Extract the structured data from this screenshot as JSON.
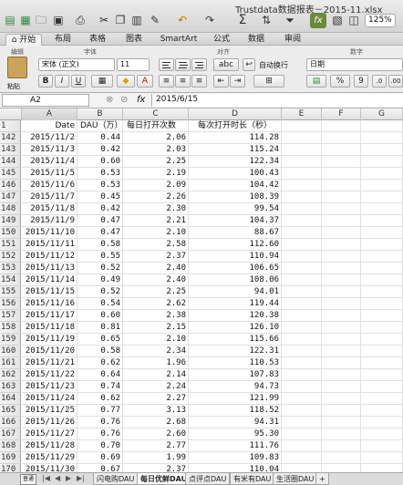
{
  "window": {
    "title": "Trustdata数据报表－2015-11.xlsx",
    "zoom": "125%"
  },
  "toolbar_icons": [
    "new-icon",
    "open-icon",
    "save-icon",
    "print-icon",
    "cut-icon",
    "copy-icon",
    "paste-icon",
    "format-painter-icon",
    "undo-icon",
    "redo-icon",
    "sum-icon",
    "sort-icon",
    "filter-icon",
    "formula-builder-icon"
  ],
  "ribbon": {
    "tabs": [
      "开始",
      "布局",
      "表格",
      "图表",
      "SmartArt",
      "公式",
      "数据",
      "审阅"
    ],
    "active_tab": "开始",
    "groups": {
      "edit": "编辑",
      "font": "字体",
      "align": "对齐",
      "number": "数字"
    },
    "paste_label": "粘贴",
    "font_name": "宋体 (正文)",
    "font_size": "11",
    "bold": "B",
    "italic": "I",
    "underline": "U",
    "wrap_text": "abc",
    "auto_wrap": "自动换行",
    "number_format": "日期",
    "percent": "%",
    "comma": "9"
  },
  "formula_bar": {
    "name_box": "A2",
    "fx": "fx",
    "content": "2015/6/15"
  },
  "columns": [
    "A",
    "B",
    "C",
    "D",
    "E",
    "F",
    "G"
  ],
  "selected_column": "A",
  "header_row": {
    "row": "1",
    "A": "Date",
    "B": "DAU（万）",
    "C": "每日打开次数",
    "D": "每次打开时长（秒）"
  },
  "rows": [
    {
      "n": "142",
      "date": "2015/11/2",
      "dau": "0.44",
      "opens": "2.06",
      "dur": "114.28"
    },
    {
      "n": "143",
      "date": "2015/11/3",
      "dau": "0.42",
      "opens": "2.03",
      "dur": "115.24"
    },
    {
      "n": "144",
      "date": "2015/11/4",
      "dau": "0.60",
      "opens": "2.25",
      "dur": "122.34"
    },
    {
      "n": "145",
      "date": "2015/11/5",
      "dau": "0.53",
      "opens": "2.19",
      "dur": "100.43"
    },
    {
      "n": "146",
      "date": "2015/11/6",
      "dau": "0.53",
      "opens": "2.09",
      "dur": "104.42"
    },
    {
      "n": "147",
      "date": "2015/11/7",
      "dau": "0.45",
      "opens": "2.26",
      "dur": "108.39"
    },
    {
      "n": "148",
      "date": "2015/11/8",
      "dau": "0.42",
      "opens": "2.30",
      "dur": "99.54"
    },
    {
      "n": "149",
      "date": "2015/11/9",
      "dau": "0.47",
      "opens": "2.21",
      "dur": "104.37"
    },
    {
      "n": "150",
      "date": "2015/11/10",
      "dau": "0.47",
      "opens": "2.10",
      "dur": "88.67"
    },
    {
      "n": "151",
      "date": "2015/11/11",
      "dau": "0.58",
      "opens": "2.58",
      "dur": "112.60"
    },
    {
      "n": "152",
      "date": "2015/11/12",
      "dau": "0.55",
      "opens": "2.37",
      "dur": "110.94"
    },
    {
      "n": "153",
      "date": "2015/11/13",
      "dau": "0.52",
      "opens": "2.40",
      "dur": "106.65"
    },
    {
      "n": "154",
      "date": "2015/11/14",
      "dau": "0.49",
      "opens": "2.40",
      "dur": "108.06"
    },
    {
      "n": "155",
      "date": "2015/11/15",
      "dau": "0.52",
      "opens": "2.25",
      "dur": "94.01"
    },
    {
      "n": "156",
      "date": "2015/11/16",
      "dau": "0.54",
      "opens": "2.62",
      "dur": "119.44"
    },
    {
      "n": "157",
      "date": "2015/11/17",
      "dau": "0.60",
      "opens": "2.38",
      "dur": "120.38"
    },
    {
      "n": "158",
      "date": "2015/11/18",
      "dau": "0.81",
      "opens": "2.15",
      "dur": "126.10"
    },
    {
      "n": "159",
      "date": "2015/11/19",
      "dau": "0.65",
      "opens": "2.10",
      "dur": "115.66"
    },
    {
      "n": "160",
      "date": "2015/11/20",
      "dau": "0.58",
      "opens": "2.34",
      "dur": "122.31"
    },
    {
      "n": "161",
      "date": "2015/11/21",
      "dau": "0.62",
      "opens": "1.96",
      "dur": "110.53"
    },
    {
      "n": "162",
      "date": "2015/11/22",
      "dau": "0.64",
      "opens": "2.14",
      "dur": "107.83"
    },
    {
      "n": "163",
      "date": "2015/11/23",
      "dau": "0.74",
      "opens": "2.24",
      "dur": "94.73"
    },
    {
      "n": "164",
      "date": "2015/11/24",
      "dau": "0.62",
      "opens": "2.27",
      "dur": "121.99"
    },
    {
      "n": "165",
      "date": "2015/11/25",
      "dau": "0.77",
      "opens": "3.13",
      "dur": "118.52"
    },
    {
      "n": "166",
      "date": "2015/11/26",
      "dau": "0.76",
      "opens": "2.68",
      "dur": "94.31"
    },
    {
      "n": "167",
      "date": "2015/11/27",
      "dau": "0.76",
      "opens": "2.60",
      "dur": "95.30"
    },
    {
      "n": "168",
      "date": "2015/11/28",
      "dau": "0.70",
      "opens": "2.77",
      "dur": "111.76"
    },
    {
      "n": "169",
      "date": "2015/11/29",
      "dau": "0.69",
      "opens": "1.99",
      "dur": "109.83"
    },
    {
      "n": "170",
      "date": "2015/11/30",
      "dau": "0.67",
      "opens": "2.37",
      "dur": "110.04"
    }
  ],
  "sheet_tabs": [
    "闪电购DAU",
    "每日优鲜DAU",
    "点评点DAU",
    "有米有DAU",
    "生活圈DAU"
  ],
  "active_sheet": "每日优鲜DAU",
  "add_sheet": "+",
  "view_label": "普通"
}
